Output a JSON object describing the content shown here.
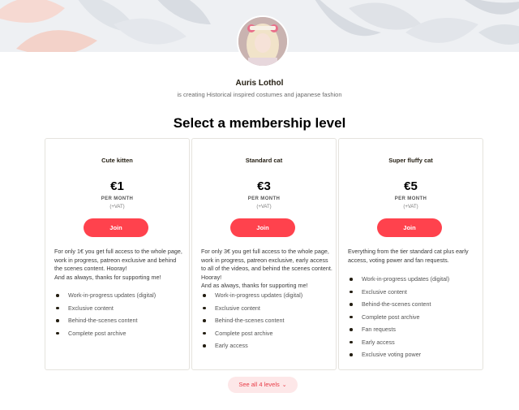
{
  "creator": {
    "name": "Auris Lothol",
    "tagline": "is creating Historical inspired costumes and japanese fashion"
  },
  "section_title": "Select a membership level",
  "tiers": [
    {
      "name": "Cute kitten",
      "price": "€1",
      "period": "PER MONTH",
      "vat": "(+VAT)",
      "join_label": "Join",
      "description": "For only 1€ you get full access to the whole page, work in progress, patreon exclusive and behind the scenes content. Hooray!\nAnd as always, thanks for supporting me!",
      "benefits": [
        "Work-in-progress updates (digital)",
        "Exclusive content",
        "Behind-the-scenes content",
        "Complete post archive"
      ]
    },
    {
      "name": "Standard cat",
      "price": "€3",
      "period": "PER MONTH",
      "vat": "(+VAT)",
      "join_label": "Join",
      "description": "For only 3€ you get full access to the whole page, work in progress, patreon exclusive, early access to all of the videos, and behind the scenes content. Hooray!\nAnd as always, thanks for supporting me!",
      "benefits": [
        "Work-in-progress updates (digital)",
        "Exclusive content",
        "Behind-the-scenes content",
        "Complete post archive",
        "Early access"
      ]
    },
    {
      "name": "Super fluffy cat",
      "price": "€5",
      "period": "PER MONTH",
      "vat": "(+VAT)",
      "join_label": "Join",
      "description": "Everything from the tier standard cat plus early access, voting power and fan requests.",
      "benefits": [
        "Work-in-progress updates (digital)",
        "Exclusive content",
        "Behind-the-scenes content",
        "Complete post archive",
        "Fan requests",
        "Early access",
        "Exclusive voting power"
      ]
    }
  ],
  "see_all_label": "See all 4 levels",
  "colors": {
    "accent": "#ff424d",
    "see_all_bg": "#fde7e8",
    "banner_bg": "#eef0f3"
  },
  "icons": {
    "see_all": "chevron-down-icon"
  }
}
